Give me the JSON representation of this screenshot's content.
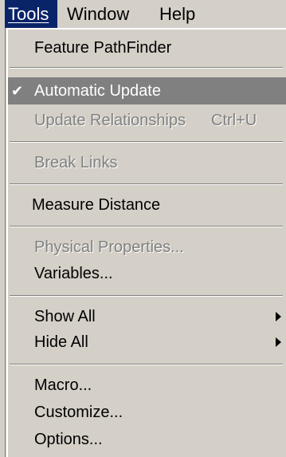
{
  "menubar": {
    "items": [
      {
        "label": "Tools",
        "access_key": "T"
      },
      {
        "label": "Window",
        "access_key": "W"
      },
      {
        "label": "Help",
        "access_key": "H"
      }
    ]
  },
  "menu": {
    "items": [
      {
        "label": "Feature PathFinder",
        "enabled": true
      },
      {
        "label": "Automatic Update",
        "enabled": true,
        "checked": true,
        "highlighted": true
      },
      {
        "label": "Update Relationships",
        "shortcut": "Ctrl+U",
        "enabled": false
      },
      {
        "label": "Break Links",
        "enabled": false
      },
      {
        "label": "Measure Distance",
        "enabled": true
      },
      {
        "label": "Physical Properties...",
        "enabled": false
      },
      {
        "label": "Variables...",
        "enabled": true
      },
      {
        "label": "Show All",
        "enabled": true,
        "submenu": true
      },
      {
        "label": "Hide All",
        "enabled": true,
        "submenu": true
      },
      {
        "label": "Macro...",
        "enabled": true
      },
      {
        "label": "Customize...",
        "enabled": true
      },
      {
        "label": "Options...",
        "enabled": true
      }
    ],
    "check_mark": "✔"
  },
  "colors": {
    "face": "#d4d0c8",
    "title_highlight": "#0a246a",
    "item_highlight": "#808080",
    "disabled_text": "#808080"
  }
}
